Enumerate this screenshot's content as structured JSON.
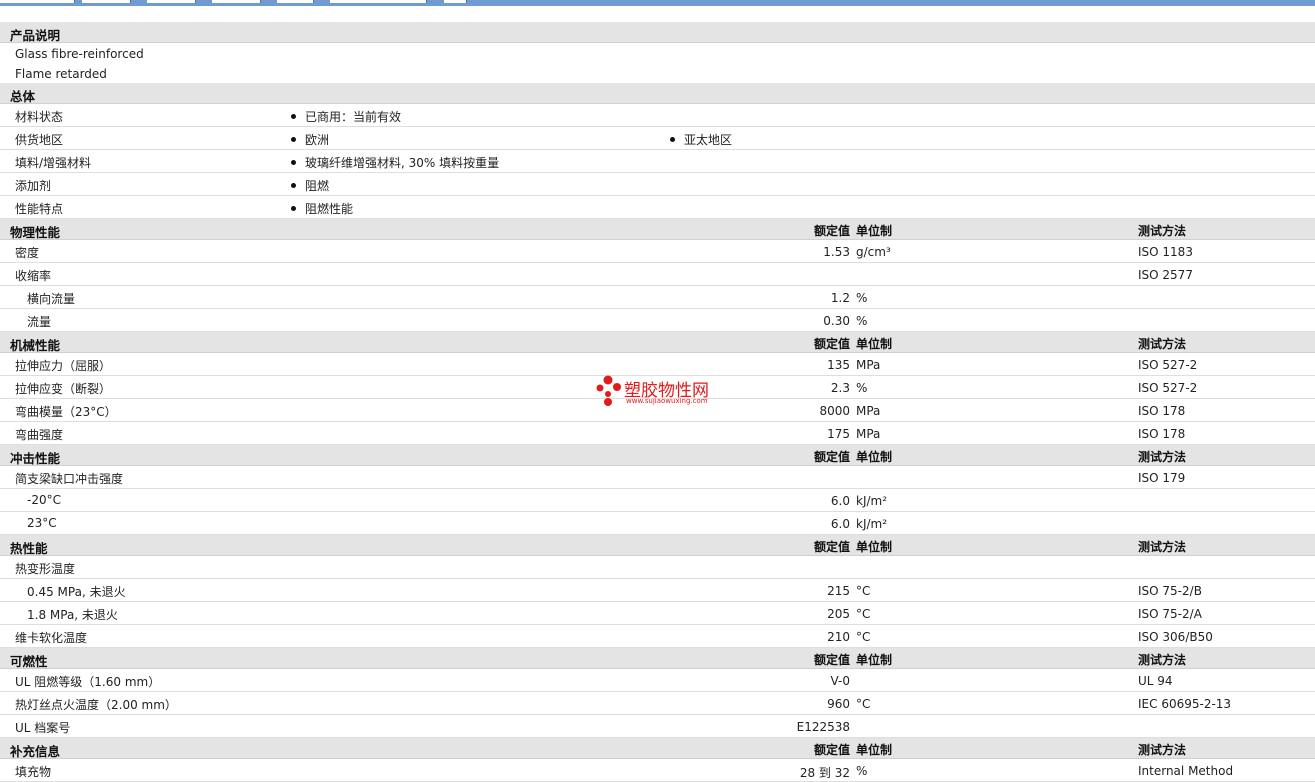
{
  "description": {
    "title": "产品说明",
    "lines": [
      "Glass fibre-reinforced",
      "Flame retarded"
    ]
  },
  "general": {
    "title": "总体",
    "rows": [
      {
        "label": "材料状态",
        "b1": "已商用：当前有效",
        "b2": ""
      },
      {
        "label": "供货地区",
        "b1": "欧洲",
        "b2": "亚太地区"
      },
      {
        "label": "填料/增强材料",
        "b1": "玻璃纤维增强材料, 30% 填料按重量",
        "b2": ""
      },
      {
        "label": "添加剂",
        "b1": "阻燃",
        "b2": ""
      },
      {
        "label": "性能特点",
        "b1": "阻燃性能",
        "b2": ""
      }
    ]
  },
  "headers": {
    "value": "额定值",
    "unit": "单位制",
    "method": "测试方法"
  },
  "physical": {
    "title": "物理性能",
    "rows": [
      {
        "label": "密度",
        "value": "1.53",
        "unit": "g/cm³",
        "method": "ISO 1183"
      },
      {
        "label": "收缩率",
        "value": "",
        "unit": "",
        "method": "ISO 2577"
      },
      {
        "label": "横向流量",
        "value": "1.2",
        "unit": "%",
        "method": ""
      },
      {
        "label": "流量",
        "value": "0.30",
        "unit": "%",
        "method": ""
      }
    ]
  },
  "mechanical": {
    "title": "机械性能",
    "rows": [
      {
        "label": "拉伸应力（屈服）",
        "value": "135",
        "unit": "MPa",
        "method": "ISO 527-2"
      },
      {
        "label": "拉伸应变（断裂）",
        "value": "2.3",
        "unit": "%",
        "method": "ISO 527-2"
      },
      {
        "label": "弯曲模量（23°C）",
        "value": "8000",
        "unit": "MPa",
        "method": "ISO 178"
      },
      {
        "label": "弯曲强度",
        "value": "175",
        "unit": "MPa",
        "method": "ISO 178"
      }
    ]
  },
  "impact": {
    "title": "冲击性能",
    "rows": [
      {
        "label": "简支梁缺口冲击强度",
        "value": "",
        "unit": "",
        "method": "ISO 179"
      },
      {
        "label": "-20°C",
        "value": "6.0",
        "unit": "kJ/m²",
        "method": ""
      },
      {
        "label": "23°C",
        "value": "6.0",
        "unit": "kJ/m²",
        "method": ""
      }
    ]
  },
  "thermal": {
    "title": "热性能",
    "rows": [
      {
        "label": "热变形温度",
        "value": "",
        "unit": "",
        "method": ""
      },
      {
        "label": "0.45 MPa, 未退火",
        "value": "215",
        "unit": "°C",
        "method": "ISO 75-2/B"
      },
      {
        "label": "1.8 MPa, 未退火",
        "value": "205",
        "unit": "°C",
        "method": "ISO 75-2/A"
      },
      {
        "label": "维卡软化温度",
        "value": "210",
        "unit": "°C",
        "method": "ISO 306/B50"
      }
    ]
  },
  "flammability": {
    "title": "可燃性",
    "rows": [
      {
        "label": "UL 阻燃等级（1.60 mm）",
        "value": "V-0",
        "unit": "",
        "method": "UL 94"
      },
      {
        "label": "热灯丝点火温度（2.00 mm）",
        "value": "960",
        "unit": "°C",
        "method": "IEC 60695-2-13"
      },
      {
        "label": "UL 档案号",
        "value": "E122538",
        "unit": "",
        "method": ""
      }
    ]
  },
  "supplemental": {
    "title": "补充信息",
    "rows": [
      {
        "label": "填充物",
        "value": "28 到  32",
        "unit": "%",
        "method": "Internal Method"
      }
    ]
  },
  "watermark": {
    "text": "塑胶物性网",
    "url": "www.sujiaowuxing.com",
    "color": "#e11b1b"
  }
}
